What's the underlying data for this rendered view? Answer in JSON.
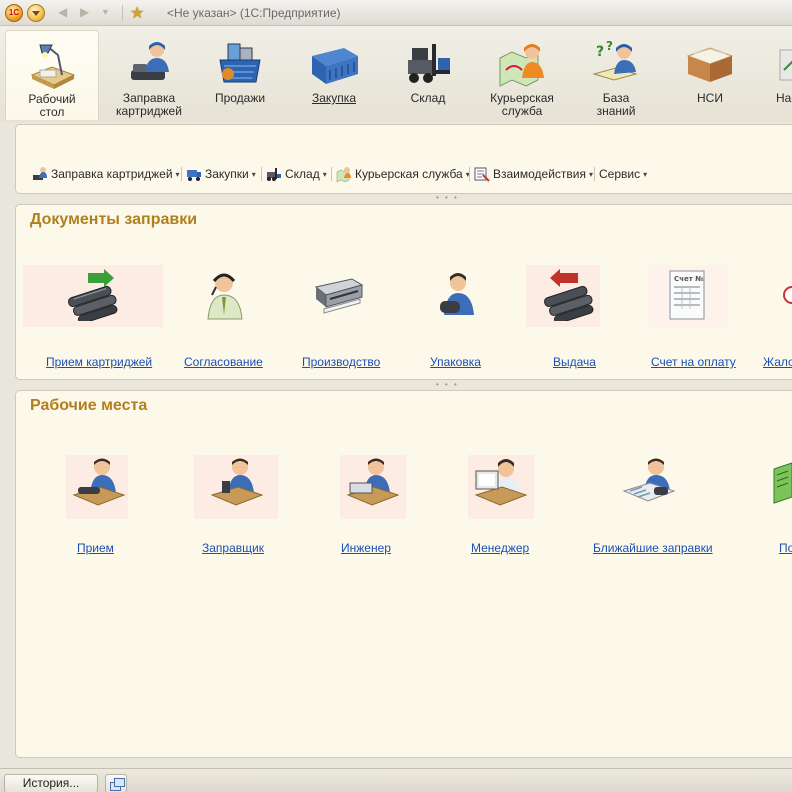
{
  "window": {
    "app_logo": "1С",
    "title": "<Не указан>  (1С:Предприятие)",
    "icons": [
      "1c-logo-icon",
      "main-menu-icon",
      "back-arrow-icon",
      "forward-arrow-icon",
      "favorites-star-icon"
    ]
  },
  "sections": {
    "active_index": 0,
    "items": [
      {
        "label": "Рабочий\nстол",
        "icon": "desktop-lamp-icon"
      },
      {
        "label": "Заправка\nкартриджей",
        "icon": "cartridge-refill-icon"
      },
      {
        "label": "Продажи",
        "icon": "sales-basket-icon"
      },
      {
        "label": "Закупка",
        "icon": "purchase-container-icon"
      },
      {
        "label": "Склад",
        "icon": "warehouse-forklift-icon"
      },
      {
        "label": "Курьерская\nслужба",
        "icon": "courier-map-icon"
      },
      {
        "label": "База\nзнаний",
        "icon": "knowledge-base-icon"
      },
      {
        "label": "НСИ",
        "icon": "reference-box-icon"
      },
      {
        "label": "Нас",
        "icon": "settings-icon"
      }
    ]
  },
  "command_bar": {
    "items": [
      {
        "label": "Заправка картриджей",
        "icon": "cartridge-refill-icon"
      },
      {
        "label": "Закупки",
        "icon": "purchase-truck-icon"
      },
      {
        "label": "Склад",
        "icon": "warehouse-forklift-icon"
      },
      {
        "label": "Курьерская служба",
        "icon": "courier-map-icon"
      },
      {
        "label": "Взаимодействия",
        "icon": "interaction-icon"
      },
      {
        "label": "Сервис",
        "icon": ""
      }
    ],
    "dropdown_arrow": "▾"
  },
  "documents": {
    "title": "Документы заправки",
    "items": [
      {
        "label": "Прием картриджей",
        "icon": "cartridge-in-icon"
      },
      {
        "label": "Согласование",
        "icon": "operator-headset-icon"
      },
      {
        "label": "Производство",
        "icon": "printer-icon"
      },
      {
        "label": "Упаковка",
        "icon": "packer-icon"
      },
      {
        "label": "Выдача",
        "icon": "cartridge-out-icon"
      },
      {
        "label": "Счет на оплату",
        "icon": "invoice-icon"
      },
      {
        "label": "Жало",
        "icon": "complaint-icon"
      }
    ]
  },
  "workplaces": {
    "title": "Рабочие места",
    "items": [
      {
        "label": "Прием",
        "icon": "reception-worker-icon"
      },
      {
        "label": "Заправщик",
        "icon": "refiller-worker-icon"
      },
      {
        "label": "Инженер",
        "icon": "engineer-worker-icon"
      },
      {
        "label": "Менеджер",
        "icon": "manager-worker-icon"
      },
      {
        "label": "Ближайшие заправки",
        "icon": "nearest-refills-icon"
      },
      {
        "label": "По",
        "icon": "report-icon"
      }
    ]
  },
  "bottom": {
    "history_label": "История...",
    "windows_icon": "windows-list-icon"
  },
  "colors": {
    "panel_bg": "#fcf9ea",
    "panel_title": "#b0801f",
    "link": "#1a4fb6",
    "tile_highlight": "#fdece4"
  }
}
